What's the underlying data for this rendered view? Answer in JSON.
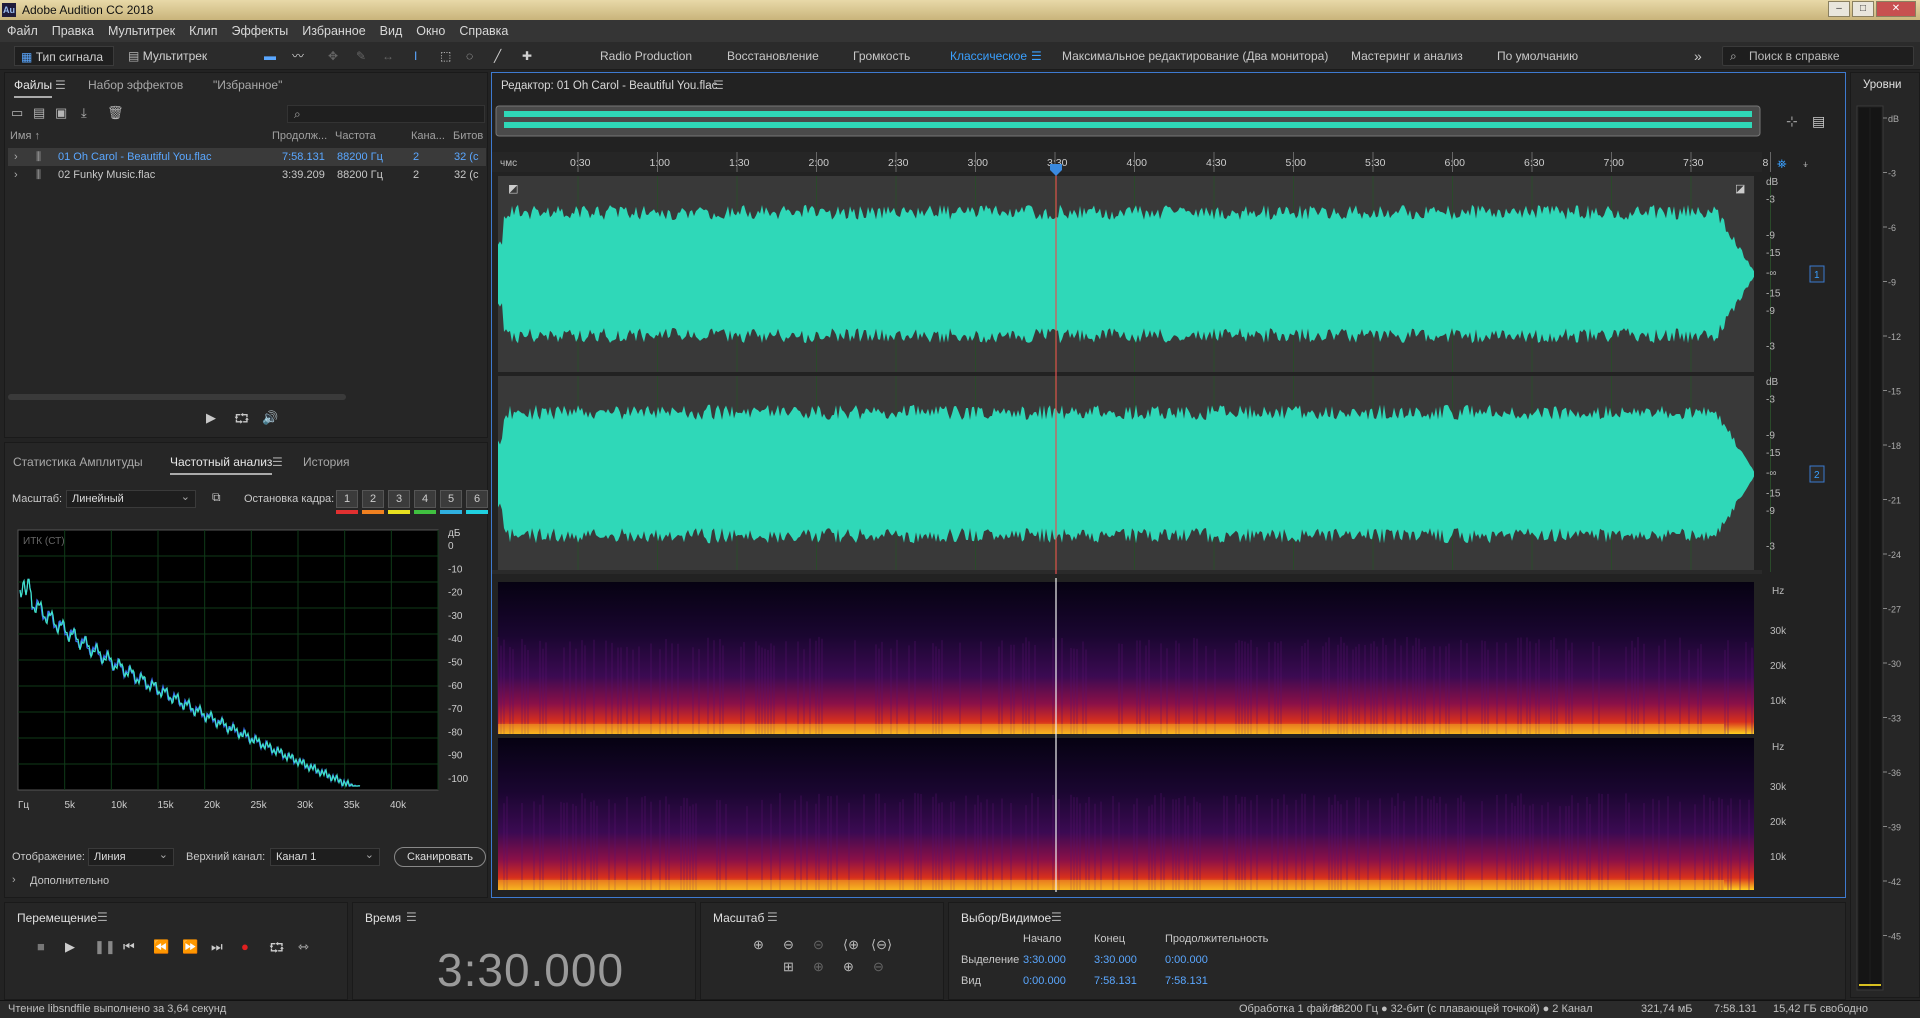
{
  "window": {
    "title": "Adobe Audition CC 2018",
    "app_icon": "Au",
    "controls": [
      "–",
      "□",
      "✕"
    ]
  },
  "menu": [
    "Файл",
    "Правка",
    "Мультитрек",
    "Клип",
    "Эффекты",
    "Избранное",
    "Вид",
    "Окно",
    "Справка"
  ],
  "toolbar": {
    "mode_waveform": "Тип сигнала",
    "mode_multitrack": "Мультитрек",
    "workspaces": [
      "Radio Production",
      "Восстановление",
      "Громкость",
      "Классическое",
      "Максимальное редактирование (Два монитора)",
      "Мастеринг и анализ",
      "По умолчанию"
    ],
    "active_workspace": "Классическое",
    "more": "»",
    "search_placeholder": "Поиск в справке"
  },
  "files_panel": {
    "tabs": [
      "Файлы",
      "Набор эффектов",
      "\"Избранное\""
    ],
    "search_placeholder": "",
    "columns": [
      "Имя ↑",
      "Продолж...",
      "Частота",
      "Кана...",
      "Битов"
    ],
    "rows": [
      {
        "name": "01 Oh Carol - Beautiful You.flac",
        "duration": "7:58.131",
        "rate": "88200 Гц",
        "channels": "2",
        "bits": "32 (с",
        "selected": true
      },
      {
        "name": "02 Funky Music.flac",
        "duration": "3:39.209",
        "rate": "88200 Гц",
        "channels": "2",
        "bits": "32 (с",
        "selected": false
      }
    ]
  },
  "freq_panel": {
    "tabs": [
      "Статистика Амплитуды",
      "Частотный анализ",
      "История"
    ],
    "scale_label": "Масштаб:",
    "scale_value": "Линейный",
    "freeze_label": "Остановка кадра:",
    "freeze_buttons": [
      "1",
      "2",
      "3",
      "4",
      "5",
      "6"
    ],
    "freeze_colors": [
      "#e03030",
      "#f08020",
      "#e8e020",
      "#40c040",
      "#30b0e0",
      "#20d0e0"
    ],
    "graph_label": "ИТК (СТ)",
    "db_unit": "дБ",
    "db_ticks": [
      "0",
      "-10",
      "-20",
      "-30",
      "-40",
      "-50",
      "-60",
      "-70",
      "-80",
      "-90",
      "-100"
    ],
    "hz_ticks": [
      "Гц",
      "5k",
      "10k",
      "15k",
      "20k",
      "25k",
      "30k",
      "35k",
      "40k"
    ],
    "display_label": "Отображение:",
    "display_value": "Линия",
    "channel_label": "Верхний канал:",
    "channel_value": "Канал 1",
    "scan_button": "Сканировать",
    "advanced": "Дополнительно"
  },
  "editor": {
    "title": "Редактор: 01 Oh Carol - Beautiful You.flac",
    "ruler_unit": "чмс",
    "ruler_ticks": [
      "0:30",
      "1:00",
      "1:30",
      "2:00",
      "2:30",
      "3:00",
      "3:30",
      "4:00",
      "4:30",
      "5:00",
      "5:30",
      "6:00",
      "6:30",
      "7:00",
      "7:30",
      "8"
    ],
    "db_labels": [
      "dB",
      "-3",
      "-9",
      "-15",
      "-∞",
      "-15",
      "-9",
      "-3"
    ],
    "channel_badges": [
      "1",
      "2"
    ],
    "spec_labels": [
      "Hz",
      "30k",
      "20k",
      "10k"
    ],
    "waveform_color": "#2fd8b8",
    "playhead_color": "#e05050"
  },
  "levels": {
    "title": "Уровни",
    "ticks": [
      "dB",
      "-3",
      "-6",
      "-9",
      "-12",
      "-15",
      "-18",
      "-21",
      "-24",
      "-27",
      "-30",
      "-33",
      "-36",
      "-39",
      "-42",
      "-45"
    ]
  },
  "transport": {
    "title": "Перемещение",
    "buttons": [
      "stop",
      "play",
      "pause",
      "rewind-start",
      "rewind",
      "fast-forward",
      "forward-end",
      "record",
      "loop",
      "skip"
    ]
  },
  "time_panel": {
    "title": "Время",
    "value": "3:30.000"
  },
  "zoom_panel": {
    "title": "Масштаб"
  },
  "selection_panel": {
    "title": "Выбор/Видимое",
    "headers": [
      "Начало",
      "Конец",
      "Продолжительность"
    ],
    "rows": [
      {
        "label": "Выделение",
        "start": "3:30.000",
        "end": "3:30.000",
        "duration": "0:00.000"
      },
      {
        "label": "Вид",
        "start": "0:00.000",
        "end": "7:58.131",
        "duration": "7:58.131"
      }
    ]
  },
  "status": {
    "left": "Чтение libsndfile выполнено за 3,64 секунд",
    "processing": "Обработка 1 файла...",
    "format": "88200 Гц ● 32-бит (с плавающей точкой) ● 2 Канал",
    "size": "321,74 мБ",
    "duration": "7:58.131",
    "free": "15,42 ГБ свободно"
  }
}
